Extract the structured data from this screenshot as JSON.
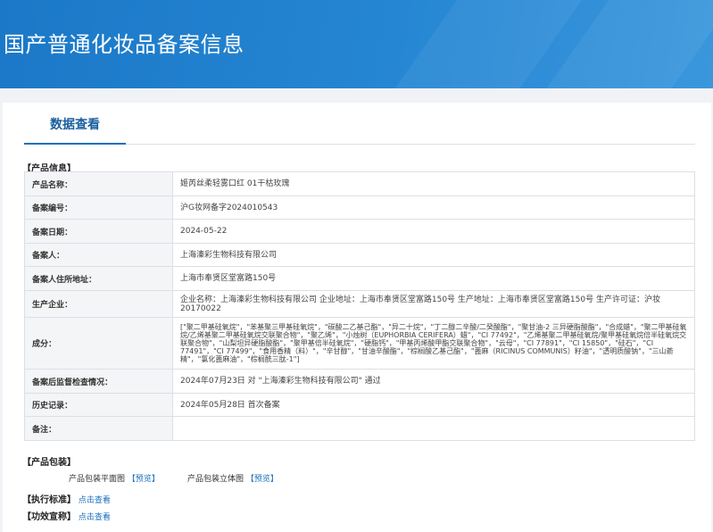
{
  "header": {
    "title": "国产普通化妆品备案信息"
  },
  "tab": {
    "label": "数据查看"
  },
  "product_section": {
    "title": "【产品信息】"
  },
  "rows": [
    {
      "label": "产品名称：",
      "value": "姬芮丝柔轻雾口红 01干枯玫瑰"
    },
    {
      "label": "备案编号：",
      "value": "沪G妆网备字2024010543"
    },
    {
      "label": "备案日期：",
      "value": "2024-05-22"
    },
    {
      "label": "备案人：",
      "value": "上海溱彩生物科技有限公司"
    },
    {
      "label": "备案人住所地址：",
      "value": "上海市奉贤区堂富路150号"
    },
    {
      "label": "生产企业：",
      "value": "企业名称：上海溱彩生物科技有限公司 企业地址：上海市奉贤区堂富路150号 生产地址：上海市奉贤区堂富路150号 生产许可证：沪妆20170022"
    },
    {
      "label": "成分：",
      "value": "[\"聚二甲基硅氧烷\"，\"苯基聚三甲基硅氧烷\"，\"碳酸二乙基己酯\"，\"异二十烷\"，\"丁二醇二辛酸/二癸酸酯\"，\"聚甘油-2 三异硬脂酸酯\"，\"合成蜡\"，\"聚二甲基硅氧烷/乙烯基聚二甲基硅氧烷交联聚合物\"，\"聚乙烯\"，\"小烛树（EUPHORBIA CERIFERA）蜡\"，\"CI 77492\"，\"乙烯基聚二甲基硅氧烷/聚甲基硅氧烷倍半硅氧烷交联聚合物\"，\"山梨坦异硬脂酸酯\"，\"聚甲基倍半硅氧烷\"，\"硬脂钙\"，\"甲基丙烯酸甲酯交联聚合物\"，\"云母\"，\"CI 77891\"，\"CI 15850\"，\"硅石\"，\"CI 77491\"，\"CI 77499\"，\"食用香精（料）\"，\"辛甘醇\"，\"甘油辛酸酯\"，\"棕榈酸乙基己酯\"，\"蓖麻（RICINUS COMMUNIS）籽油\"，\"透明质酸钠\"，\"三山萮精\"，\"氯化蓖麻油\"，\"棕榈酰三肽-1\"]"
    },
    {
      "label": "备案后监督检查情况：",
      "value": "2024年07月23日 对 \"上海溱彩生物科技有限公司\" 通过"
    },
    {
      "label": "历史记录：",
      "value": "2024年05月28日 首次备案"
    },
    {
      "label": "备注：",
      "value": ""
    }
  ],
  "packaging": {
    "title": "【产品包装】",
    "flat_label": "产品包装平面图",
    "flat_link": "【预览】",
    "solid_label": "产品包装立体图",
    "solid_link": "【预览】"
  },
  "standard": {
    "title": "【执行标准】",
    "link": "点击查看"
  },
  "efficacy": {
    "title": "【功效宣称】",
    "link": "点击查看"
  }
}
